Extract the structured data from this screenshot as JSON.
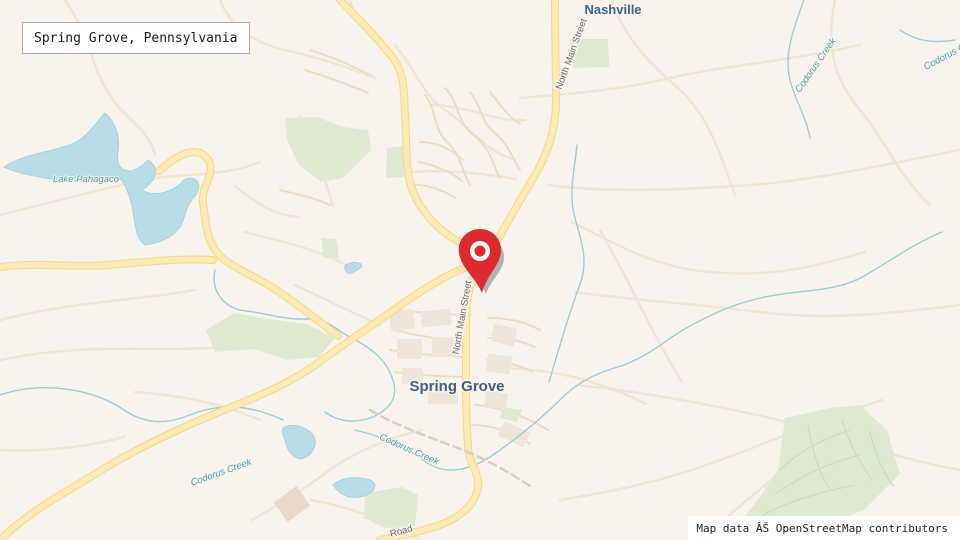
{
  "map": {
    "location_label": "Spring Grove, Pennsylvania",
    "attribution": "Map data ÂŠ OpenStreetMap contributors",
    "places": {
      "nashville": "Nashville",
      "spring_grove": "Spring Grove"
    },
    "water": {
      "lake_pahagaco": "Lake Pahagaco",
      "codorus_creek": "Codorus Creek"
    },
    "roads": {
      "north_main_street": "North Main Street",
      "road_partial": "Road"
    },
    "marker": {
      "icon": "map-pin-icon",
      "color": "#dc2b30"
    },
    "colors": {
      "land": "#f8f4ed",
      "water": "#b7dde6",
      "park": "#dfe9d2",
      "major_road": "#fce8b0",
      "minor_road": "#efe5d3",
      "label_blue": "#3e5f87"
    }
  }
}
